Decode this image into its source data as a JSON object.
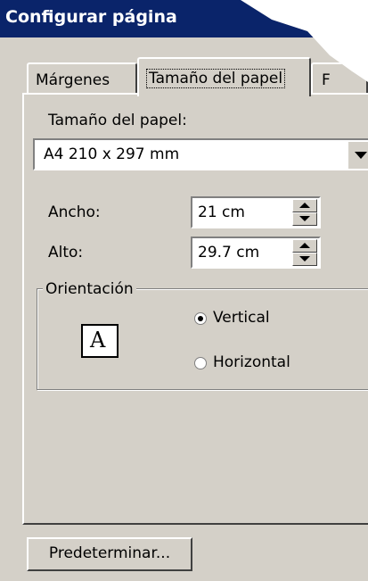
{
  "window": {
    "title": "Configurar página"
  },
  "tabs": [
    {
      "label": "Márgenes",
      "active": false
    },
    {
      "label": "Tamaño del papel",
      "active": true
    },
    {
      "label": "F",
      "active": false
    }
  ],
  "paper_size": {
    "label": "Tamaño del papel:",
    "value": "A4 210 x 297 mm"
  },
  "width_field": {
    "label": "Ancho:",
    "value": "21 cm"
  },
  "height_field": {
    "label": "Alto:",
    "value": "29.7 cm"
  },
  "orientation": {
    "title": "Orientación",
    "page_icon_letter": "A",
    "options": [
      {
        "label": "Vertical",
        "selected": true
      },
      {
        "label": "Horizontal",
        "selected": false
      }
    ]
  },
  "buttons": {
    "default_label": "Predeterminar..."
  },
  "colors": {
    "titlebar": "#0a246a",
    "dialog": "#d4d0c8"
  }
}
